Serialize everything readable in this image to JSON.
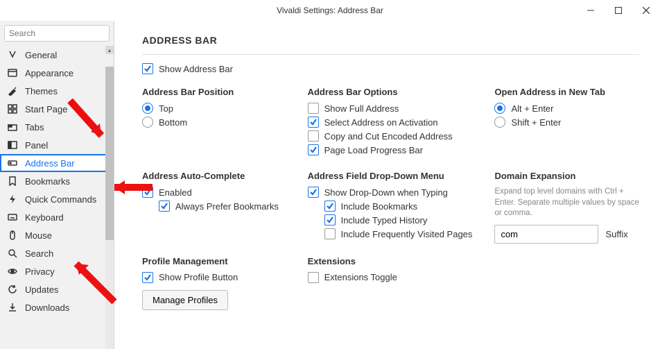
{
  "title": "Vivaldi Settings: Address Bar",
  "search": {
    "placeholder": "Search"
  },
  "sidebar": {
    "items": [
      {
        "label": "General"
      },
      {
        "label": "Appearance"
      },
      {
        "label": "Themes"
      },
      {
        "label": "Start Page"
      },
      {
        "label": "Tabs"
      },
      {
        "label": "Panel"
      },
      {
        "label": "Address Bar",
        "selected": true
      },
      {
        "label": "Bookmarks"
      },
      {
        "label": "Quick Commands"
      },
      {
        "label": "Keyboard"
      },
      {
        "label": "Mouse"
      },
      {
        "label": "Search"
      },
      {
        "label": "Privacy"
      },
      {
        "label": "Updates"
      },
      {
        "label": "Downloads"
      }
    ]
  },
  "main": {
    "heading": "ADDRESS BAR",
    "show_address_bar": "Show Address Bar",
    "groups": {
      "position": {
        "title": "Address Bar Position",
        "options": [
          "Top",
          "Bottom"
        ]
      },
      "options": {
        "title": "Address Bar Options",
        "items": [
          "Show Full Address",
          "Select Address on Activation",
          "Copy and Cut Encoded Address",
          "Page Load Progress Bar"
        ]
      },
      "newtab": {
        "title": "Open Address in New Tab",
        "options": [
          "Alt + Enter",
          "Shift + Enter"
        ]
      },
      "autocomplete": {
        "title": "Address Auto-Complete",
        "enabled": "Enabled",
        "prefer": "Always Prefer Bookmarks"
      },
      "dropdown": {
        "title": "Address Field Drop-Down Menu",
        "show": "Show Drop-Down when Typing",
        "include_bookmarks": "Include Bookmarks",
        "include_typed": "Include Typed History",
        "include_freq": "Include Frequently Visited Pages"
      },
      "domain": {
        "title": "Domain Expansion",
        "helper": "Expand top level domains with Ctrl + Enter. Separate multiple values by space or comma.",
        "value": "com",
        "suffix_label": "Suffix"
      },
      "profile": {
        "title": "Profile Management",
        "show_button": "Show Profile Button",
        "manage": "Manage Profiles"
      },
      "extensions": {
        "title": "Extensions",
        "toggle": "Extensions Toggle"
      }
    }
  }
}
